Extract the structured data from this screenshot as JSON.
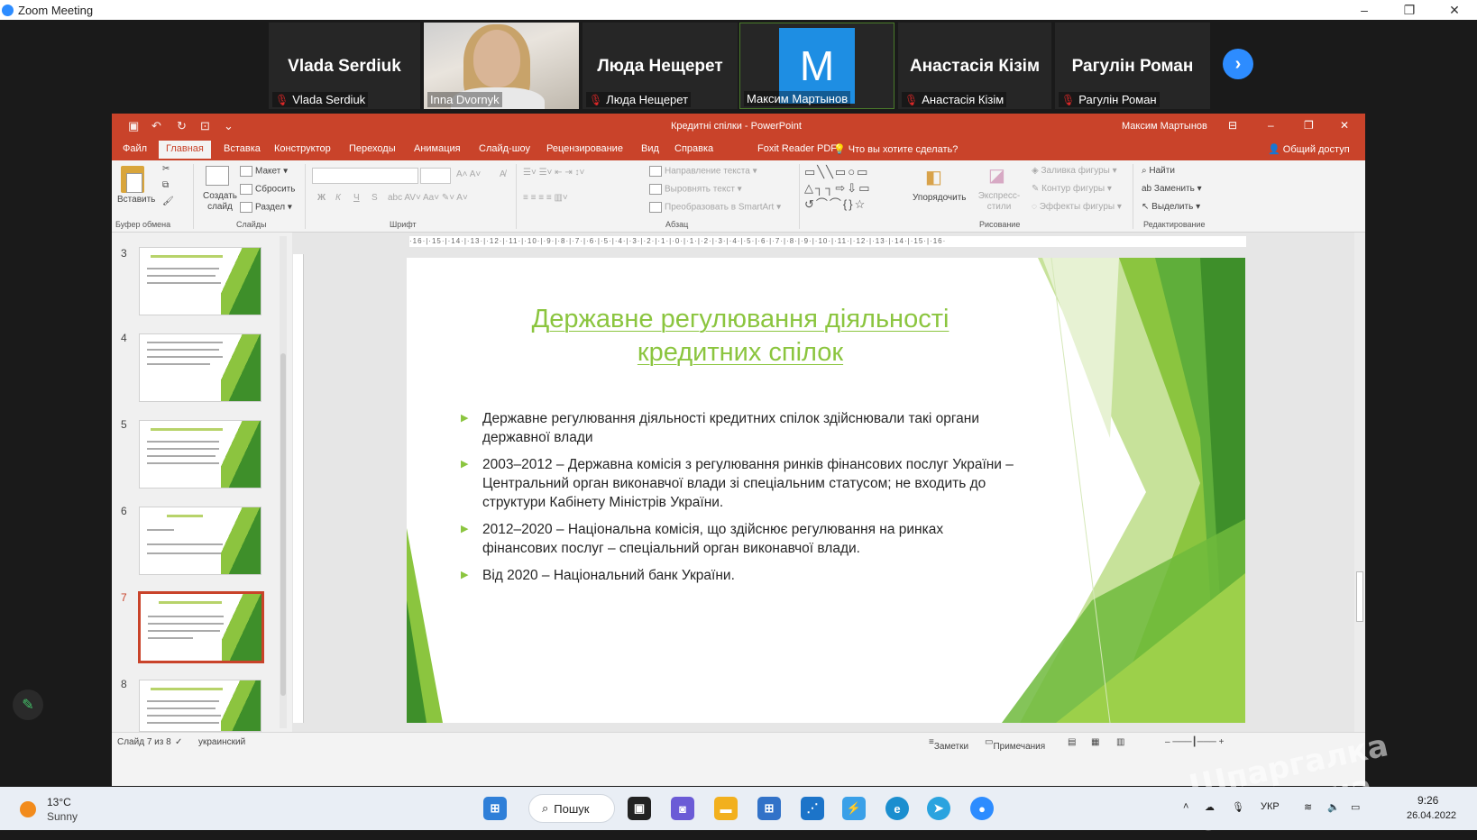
{
  "zoom": {
    "window_title": "Zoom Meeting",
    "minimize_icon": "–",
    "restore_icon": "❐",
    "close_icon": "✕",
    "participants": [
      {
        "display": "Vlada Serdiuk",
        "label": "Vlada Serdiuk",
        "muted": true,
        "kind": "name"
      },
      {
        "display": "",
        "label": "Inna Dvornyk",
        "muted": false,
        "kind": "video"
      },
      {
        "display": "Люда Нещерет",
        "label": "Люда Нещерет",
        "muted": true,
        "kind": "name"
      },
      {
        "display": "M",
        "label": "Максим Мартынов",
        "muted": false,
        "kind": "avatar",
        "avatar_color": "#1e8ee3"
      },
      {
        "display": "Анастасія Кізім",
        "label": "Анастасія Кізім",
        "muted": true,
        "kind": "name"
      },
      {
        "display": "Рагулін Роман",
        "label": "Рагулін Роман",
        "muted": true,
        "kind": "name"
      }
    ],
    "next_icon": "›"
  },
  "ppt": {
    "doc_title": "Кредитні спілки - PowerPoint",
    "user_name": "Максим Мартынов",
    "tabs": [
      "Файл",
      "Главная",
      "Вставка",
      "Конструктор",
      "Переходы",
      "Анимация",
      "Слайд-шоу",
      "Рецензирование",
      "Вид",
      "Справка",
      "Foxit Reader PDF"
    ],
    "active_tab": "Главная",
    "tell_me": "Что вы хотите сделать?",
    "share": "Общий доступ",
    "ribbon": {
      "paste": "Вставить",
      "clipboard_group": "Буфер обмена",
      "new_slide": "Создать слайд",
      "layout": "Макет",
      "reset": "Сбросить",
      "section": "Раздел",
      "slides_group": "Слайды",
      "font_group": "Шрифт",
      "text_direction": "Направление текста",
      "align_text": "Выровнять текст",
      "convert_smartart": "Преобразовать в SmartArt",
      "paragraph_group": "Абзац",
      "arrange": "Упорядочить",
      "quick_styles": "Экспресс-стили",
      "shape_fill": "Заливка фигуры",
      "shape_outline": "Контур фигуры",
      "shape_effects": "Эффекты фигуры",
      "drawing_group": "Рисование",
      "find": "Найти",
      "replace": "Заменить",
      "select": "Выделить",
      "editing_group": "Редактирование",
      "bold": "Ж",
      "italic": "К",
      "underline": "Ч",
      "strike": "S"
    },
    "thumbnails": [
      {
        "num": "3",
        "selected": false
      },
      {
        "num": "4",
        "selected": false
      },
      {
        "num": "5",
        "selected": false
      },
      {
        "num": "6",
        "selected": false
      },
      {
        "num": "7",
        "selected": true
      },
      {
        "num": "8",
        "selected": false
      }
    ],
    "ruler_text": "·16·|·15·|·14·|·13·|·12·|·11·|·10·|·9·|·8·|·7·|·6·|·5·|·4·|·3·|·2·|·1·|·0·|·1·|·2·|·3·|·4·|·5·|·6·|·7·|·8·|·9·|·10·|·11·|·12·|·13·|·14·|·15·|·16·",
    "slide": {
      "title": "Державне регулювання діяльності кредитних спілок",
      "bullets": [
        "Державне регулювання діяльності кредитних спілок здійснювали такі органи державної влади",
        "2003–2012 – Державна комісія з регулювання ринків фінансових послуг України – Центральний орган виконавчої влади зі спеціальним статусом; не входить до структури Кабінету Міністрів України.",
        "2012–2020 – Національна комісія, що здійснює регулювання на ринках фінансових послуг – спеціальний орган виконавчої влади.",
        "Від 2020 – Національний банк України."
      ],
      "accent_color": "#8bc53f"
    },
    "status": {
      "slide_counter": "Слайд 7 из 8",
      "language": "украинский",
      "notes": "Заметки",
      "comments": "Примечания"
    }
  },
  "taskbar": {
    "temp": "13°C",
    "weather": "Sunny",
    "search": "Пошук",
    "lang": "УКР",
    "time": "9:26",
    "date": "26.04.2022"
  },
  "watermark": "Шпаргалка Ua.info.ua"
}
